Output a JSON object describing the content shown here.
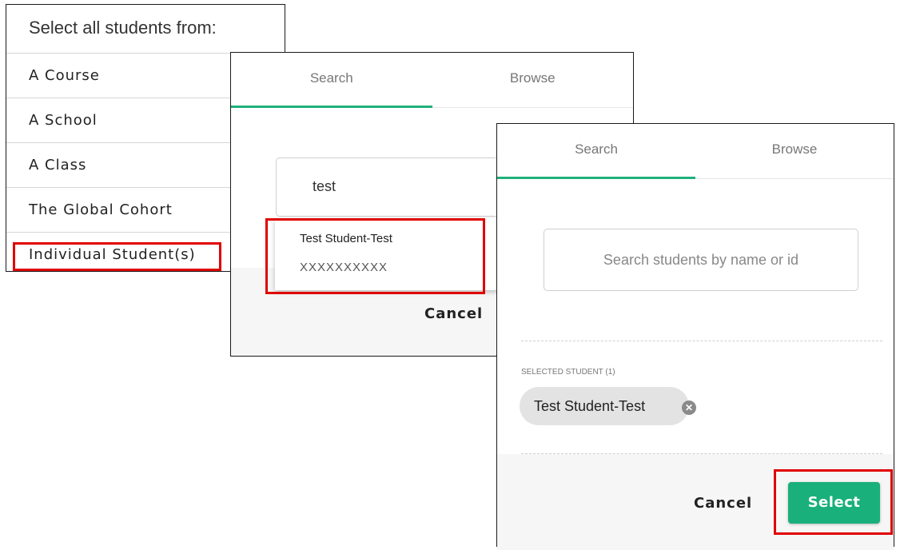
{
  "panel1": {
    "title": "Select all students from:",
    "options": [
      "A Course",
      "A School",
      "A Class",
      "The Global Cohort",
      "Individual Student(s)"
    ]
  },
  "panel2": {
    "tabs": [
      "Search",
      "Browse"
    ],
    "search_value": "test",
    "result_name": "Test Student-Test",
    "result_id": "XXXXXXXXXX",
    "cancel_label": "Cancel"
  },
  "panel3": {
    "tabs": [
      "Search",
      "Browse"
    ],
    "search_placeholder": "Search students by name or id",
    "selected_header": "SELECTED STUDENT (1)",
    "chip_label": "Test Student-Test",
    "cancel_label": "Cancel",
    "select_label": "Select"
  },
  "colors": {
    "accent": "#19b07c",
    "highlight": "#e00000"
  },
  "icons": {
    "chip_remove": "close-circle-icon"
  }
}
